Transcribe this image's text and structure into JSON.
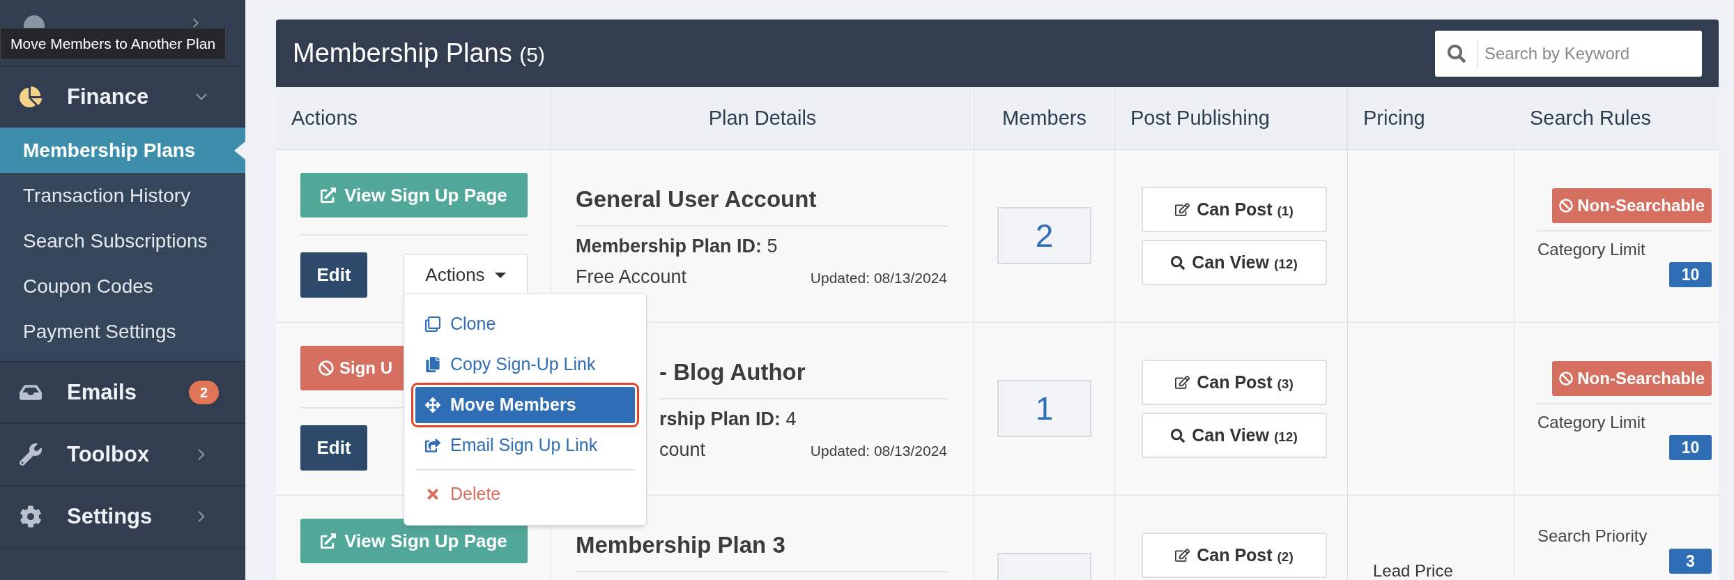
{
  "tooltip": "Move Members to Another Plan",
  "sidebar": {
    "items": [
      {
        "label": "Finance",
        "kind": "finance",
        "expanded": true,
        "children": [
          {
            "label": "Membership Plans",
            "selected": true
          },
          {
            "label": "Transaction History",
            "selected": false
          },
          {
            "label": "Search Subscriptions",
            "selected": false
          },
          {
            "label": "Coupon Codes",
            "selected": false
          },
          {
            "label": "Payment Settings",
            "selected": false
          }
        ]
      },
      {
        "label": "Emails",
        "kind": "emails",
        "badge": "2"
      },
      {
        "label": "Toolbox",
        "kind": "toolbox",
        "expanded": false
      },
      {
        "label": "Settings",
        "kind": "settings",
        "expanded": false
      }
    ]
  },
  "panel": {
    "title": "Membership Plans",
    "count": "(5)",
    "search": {
      "placeholder": "Search by Keyword"
    }
  },
  "table": {
    "columns": [
      "Actions",
      "Plan Details",
      "Members",
      "Post Publishing",
      "Pricing",
      "Search Rules"
    ],
    "rows": [
      {
        "actions": {
          "primary": {
            "label": "View Sign Up Page",
            "kind": "view"
          },
          "edit": "Edit",
          "menu": "Actions"
        },
        "details": {
          "title": "General User Account",
          "id_label": "Membership Plan ID:",
          "id_value": "5",
          "type": "Free Account",
          "updated": "Updated: 08/13/2024"
        },
        "members": "2",
        "post": [
          {
            "label": "Can Post",
            "count": "(1)",
            "kind": "post"
          },
          {
            "label": "Can View",
            "count": "(12)",
            "kind": "view"
          }
        ],
        "search": {
          "status": "Non-Searchable",
          "rule_label": "Category Limit",
          "rule_value": "10"
        }
      },
      {
        "actions": {
          "primary": {
            "label": "Sign U",
            "kind": "blocked"
          },
          "edit": "Edit"
        },
        "details": {
          "title": "- Blog Author",
          "id_label": "rship Plan ID:",
          "id_value": "4",
          "type": "count",
          "updated": "Updated: 08/13/2024"
        },
        "members": "1",
        "post": [
          {
            "label": "Can Post",
            "count": "(3)",
            "kind": "post"
          },
          {
            "label": "Can View",
            "count": "(12)",
            "kind": "view"
          }
        ],
        "search": {
          "status": "Non-Searchable",
          "rule_label": "Category Limit",
          "rule_value": "10"
        }
      },
      {
        "actions": {
          "primary": {
            "label": "View Sign Up Page",
            "kind": "view"
          }
        },
        "details": {
          "title": "Membership Plan 3"
        },
        "post": [
          {
            "label": "Can Post",
            "count": "(2)",
            "kind": "post"
          }
        ],
        "pricing": "Lead Price",
        "search": {
          "rule_label": "Search Priority",
          "rule_value": "3"
        }
      }
    ]
  },
  "dropdown": {
    "items": [
      {
        "label": "Clone",
        "kind": "clone",
        "selected": false
      },
      {
        "label": "Copy Sign-Up Link",
        "kind": "copy",
        "selected": false
      },
      {
        "label": "Move Members",
        "kind": "move",
        "selected": true
      },
      {
        "label": "Email Sign Up Link",
        "kind": "email",
        "selected": false
      },
      {
        "label": "Delete",
        "kind": "delete",
        "selected": false
      }
    ]
  }
}
